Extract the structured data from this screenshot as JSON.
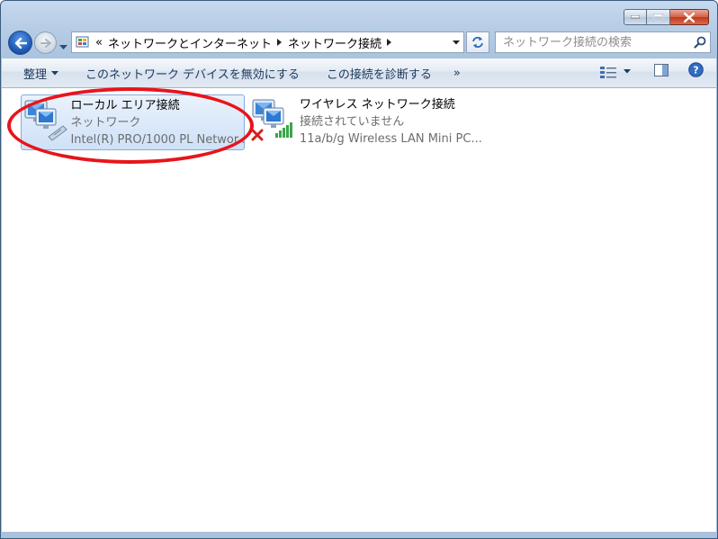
{
  "window": {
    "caption_buttons": [
      "minimize",
      "maximize",
      "close"
    ]
  },
  "nav": {
    "address_prefix": "«",
    "breadcrumbs": [
      "ネットワークとインターネット",
      "ネットワーク接続"
    ],
    "search_placeholder": "ネットワーク接続の検索"
  },
  "toolbar": {
    "organize": "整理",
    "disable_device": "このネットワーク デバイスを無効にする",
    "diagnose": "この接続を診断する",
    "more": "»"
  },
  "connections": [
    {
      "name": "ローカル エリア接続",
      "status": "ネットワーク",
      "device": "Intel(R) PRO/1000 PL Networ...",
      "selected": true
    },
    {
      "name": "ワイヤレス ネットワーク接続",
      "status": "接続されていません",
      "device": "11a/b/g Wireless LAN Mini PC...",
      "selected": false
    }
  ],
  "colors": {
    "annotation": "#e8141b",
    "selection": "#cfe1f7",
    "toolbar_text": "#1e395b"
  }
}
